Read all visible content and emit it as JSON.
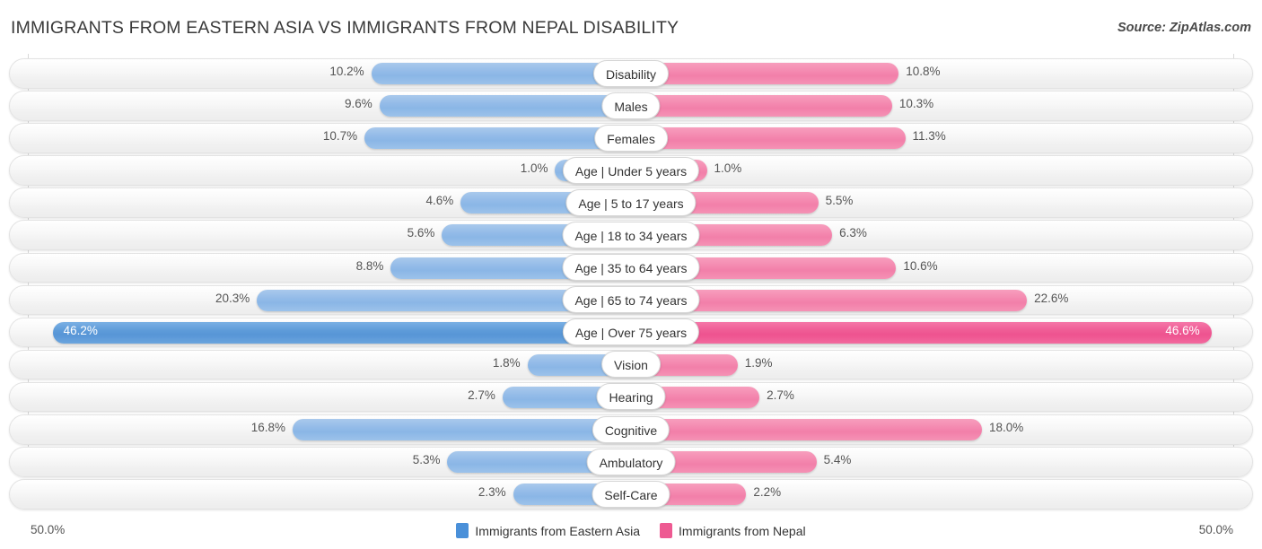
{
  "header": {
    "title": "IMMIGRANTS FROM EASTERN ASIA VS IMMIGRANTS FROM NEPAL DISABILITY",
    "source": "Source: ZipAtlas.com"
  },
  "footer": {
    "axis_min_label": "50.0%",
    "axis_max_label": "50.0%",
    "legend": [
      {
        "label": "Immigrants from Eastern Asia",
        "color": "#4a90d9"
      },
      {
        "label": "Immigrants from Nepal",
        "color": "#ee5a92"
      }
    ]
  },
  "colors": {
    "left_series": "#8ab6e6",
    "right_series": "#f27fa9",
    "left_series_highlight": "#5795d6",
    "right_series_highlight": "#ee538f",
    "track": "#f1f1f1",
    "axis_line": "#d8d8d8"
  },
  "chart_data": {
    "type": "bar",
    "orientation": "diverging-horizontal",
    "title": "IMMIGRANTS FROM EASTERN ASIA VS IMMIGRANTS FROM NEPAL DISABILITY",
    "xlabel": "",
    "ylabel": "",
    "xlim": [
      50.0,
      50.0
    ],
    "grid": false,
    "legend_position": "bottom-center",
    "axis_tick_labels": [
      "50.0%",
      "50.0%"
    ],
    "categories": [
      "Disability",
      "Males",
      "Females",
      "Age | Under 5 years",
      "Age | 5 to 17 years",
      "Age | 18 to 34 years",
      "Age | 35 to 64 years",
      "Age | 65 to 74 years",
      "Age | Over 75 years",
      "Vision",
      "Hearing",
      "Cognitive",
      "Ambulatory",
      "Self-Care"
    ],
    "series": [
      {
        "name": "Immigrants from Eastern Asia",
        "color": "#8ab6e6",
        "values": [
          10.2,
          9.6,
          10.7,
          1.0,
          4.6,
          5.6,
          8.8,
          20.3,
          46.2,
          1.8,
          2.7,
          16.8,
          5.3,
          2.3
        ],
        "labels": [
          "10.2%",
          "9.6%",
          "10.7%",
          "1.0%",
          "4.6%",
          "5.6%",
          "8.8%",
          "20.3%",
          "46.2%",
          "1.8%",
          "2.7%",
          "16.8%",
          "5.3%",
          "2.3%"
        ]
      },
      {
        "name": "Immigrants from Nepal",
        "color": "#f27fa9",
        "values": [
          10.8,
          10.3,
          11.3,
          1.0,
          5.5,
          6.3,
          10.6,
          22.6,
          46.6,
          1.9,
          2.7,
          18.0,
          5.4,
          2.2
        ],
        "labels": [
          "10.8%",
          "10.3%",
          "11.3%",
          "1.0%",
          "5.5%",
          "6.3%",
          "10.6%",
          "22.6%",
          "46.6%",
          "1.9%",
          "2.7%",
          "18.0%",
          "5.4%",
          "2.2%"
        ]
      }
    ],
    "highlight_row_index": 8
  }
}
